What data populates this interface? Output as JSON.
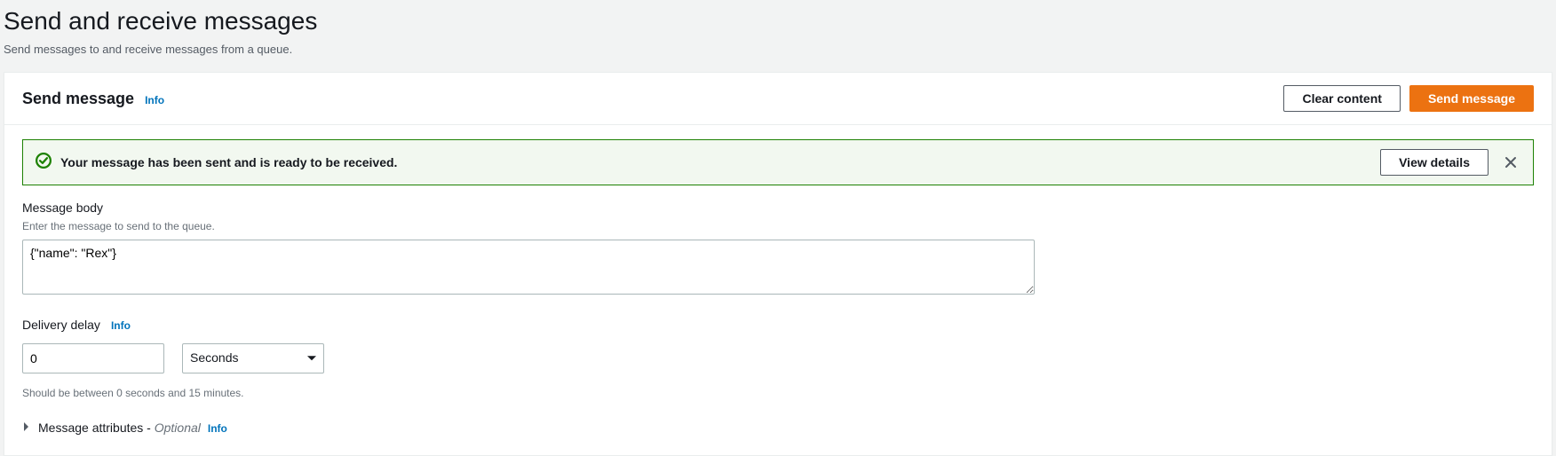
{
  "page": {
    "title": "Send and receive messages",
    "subtitle": "Send messages to and receive messages from a queue."
  },
  "panel": {
    "title": "Send message",
    "info": "Info",
    "clear_btn": "Clear content",
    "send_btn": "Send message"
  },
  "alert": {
    "message": "Your message has been sent and is ready to be received.",
    "view_details": "View details"
  },
  "body_field": {
    "label": "Message body",
    "hint": "Enter the message to send to the queue.",
    "value": "{\"name\": \"Rex\"}"
  },
  "delay": {
    "label": "Delivery delay",
    "info": "Info",
    "value": "0",
    "unit": "Seconds",
    "constraint": "Should be between 0 seconds and 15 minutes."
  },
  "attributes": {
    "label": "Message attributes - ",
    "optional": "Optional",
    "info": "Info"
  }
}
